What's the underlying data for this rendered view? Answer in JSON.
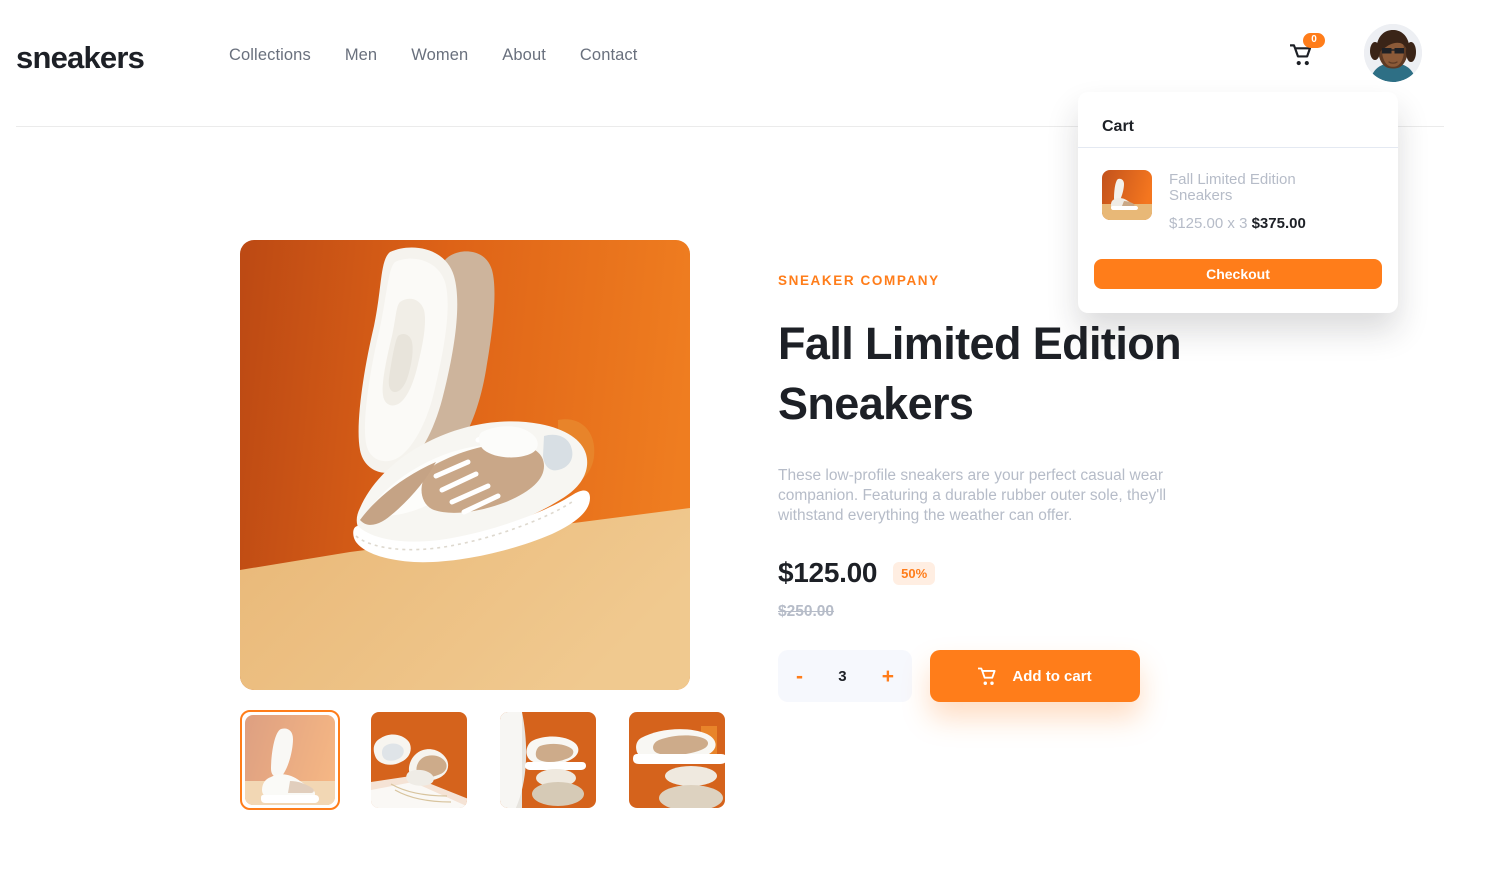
{
  "header": {
    "logo": "sneakers",
    "nav": [
      {
        "label": "Collections"
      },
      {
        "label": "Men"
      },
      {
        "label": "Women"
      },
      {
        "label": "About"
      },
      {
        "label": "Contact"
      }
    ],
    "cart_icon": "shopping-cart-icon",
    "cart_badge_count": "0",
    "avatar_alt": "user-avatar"
  },
  "cart_panel": {
    "title": "Cart",
    "item": {
      "name": "Fall Limited Edition Sneakers",
      "unit_price": "$125.00",
      "multiplier": "x 3",
      "line_total": "$375.00",
      "thumb_alt": "cart-item-thumbnail"
    },
    "checkout_label": "Checkout"
  },
  "gallery": {
    "main_image_alt": "product-image-1",
    "thumbnails": [
      {
        "alt": "product-thumbnail-1",
        "selected": true
      },
      {
        "alt": "product-thumbnail-2",
        "selected": false
      },
      {
        "alt": "product-thumbnail-3",
        "selected": false
      },
      {
        "alt": "product-thumbnail-4",
        "selected": false
      }
    ]
  },
  "product": {
    "brand": "SNEAKER COMPANY",
    "title": "Fall Limited Edition Sneakers",
    "description": "These low-profile sneakers are your perfect casual wear companion. Featuring a durable rubber outer sole, they'll withstand everything the weather can offer.",
    "price": "$125.00",
    "discount": "50%",
    "old_price": "$250.00",
    "quantity": "3",
    "minus_label": "-",
    "plus_label": "+",
    "add_to_cart_label": "Add to cart",
    "add_to_cart_icon": "shopping-cart-icon"
  },
  "colors": {
    "accent": "#ff7d1a",
    "accent_pale": "#ffeee2",
    "dark": "#1d2026",
    "grey_text": "#69707d",
    "light_grey_text": "#b6bcc8",
    "pale_bg": "#f6f8fd"
  }
}
